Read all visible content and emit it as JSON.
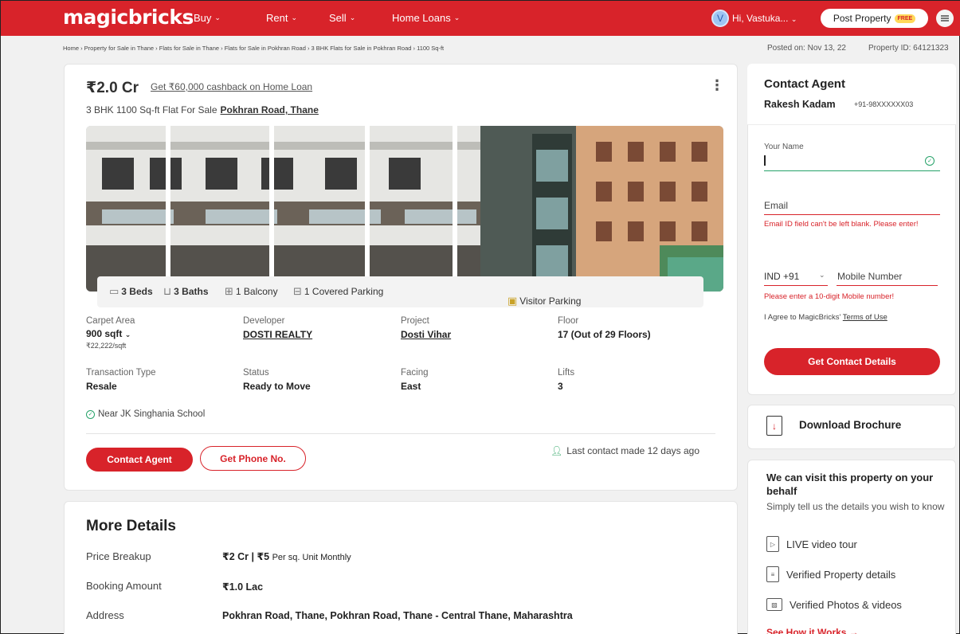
{
  "nav": {
    "logo": "magicbricks",
    "items": [
      {
        "label": "Buy"
      },
      {
        "label": "Rent"
      },
      {
        "label": "Sell"
      },
      {
        "label": "Home Loans"
      }
    ],
    "user_initial": "V",
    "user_greeting": "Hi, Vastuka...",
    "post_property_label": "Post Property",
    "free_badge": "FREE",
    "brand_color": "#d8232a"
  },
  "breadcrumb": "Home › Property for Sale in Thane › Flats for Sale in Thane › Flats for Sale in Pokhran Road › 3 BHK Flats for Sale in Pokhran Road › 1100 Sq-ft",
  "posted_on": "Posted on: Nov 13, 22",
  "property_id": "Property ID: 64121323",
  "listing": {
    "price": "₹2.0 Cr",
    "cashback": "Get ₹60,000 cashback on Home Loan",
    "subtitle": "3 BHK 1100 Sq-ft Flat For Sale",
    "location": "Pokhran Road, Thane",
    "amenities": {
      "beds": "3 Beds",
      "baths": "3 Baths",
      "balcony": "1 Balcony",
      "parking": "1 Covered Parking",
      "visitor_parking": "Visitor Parking"
    },
    "attributes": {
      "carpet_area_label": "Carpet Area",
      "carpet_area_value": "900 sqft",
      "price_per_sqft": "₹22,222/sqft",
      "developer_label": "Developer",
      "developer_value": "DOSTI REALTY",
      "project_label": "Project",
      "project_value": "Dosti Vihar",
      "floor_label": "Floor",
      "floor_value": "17 (Out of 29 Floors)",
      "transaction_label": "Transaction Type",
      "transaction_value": "Resale",
      "status_label": "Status",
      "status_value": "Ready to Move",
      "facing_label": "Facing",
      "facing_value": "East",
      "lifts_label": "Lifts",
      "lifts_value": "3"
    },
    "near": "Near JK Singhania School",
    "contact_agent_btn": "Contact Agent",
    "get_phone_btn": "Get Phone No.",
    "last_contact": "Last contact made 12 days ago"
  },
  "more_details": {
    "title": "More Details",
    "price_breakup_label": "Price Breakup",
    "price_breakup_value": "₹2 Cr | ₹5",
    "price_breakup_suffix": "Per sq. Unit Monthly",
    "booking_label": "Booking Amount",
    "booking_value": "₹1.0 Lac",
    "address_label": "Address",
    "address_value": "Pokhran Road, Thane, Pokhran Road, Thane - Central Thane, Maharashtra"
  },
  "contact_form": {
    "title": "Contact Agent",
    "agent_name": "Rakesh Kadam",
    "agent_phone": "+91-98XXXXXX03",
    "name_label": "Your Name",
    "name_value": "",
    "email_placeholder": "Email",
    "email_error": "Email ID field can't be left blank. Please enter!",
    "country_code": "IND +91",
    "mobile_placeholder": "Mobile Number",
    "mobile_error": "Please enter a 10-digit Mobile number!",
    "agree_text": "I Agree to MagicBricks'",
    "terms_link": "Terms of Use",
    "submit_label": "Get Contact Details"
  },
  "brochure": {
    "label": "Download Brochure"
  },
  "visit": {
    "title": "We can visit this property on your behalf",
    "subtitle": "Simply tell us the details you wish to know",
    "items": [
      {
        "label": "LIVE video tour"
      },
      {
        "label": "Verified Property details"
      },
      {
        "label": "Verified Photos & videos"
      }
    ],
    "see_how": "See How it Works →"
  }
}
